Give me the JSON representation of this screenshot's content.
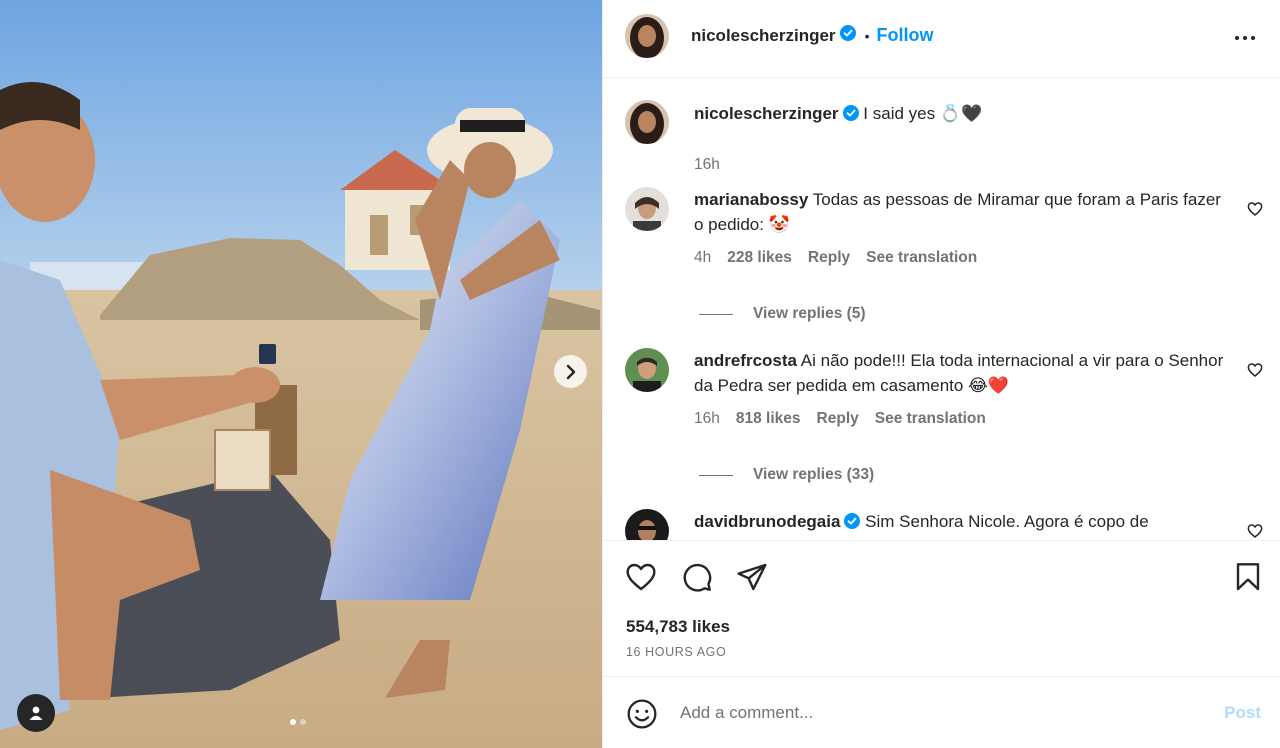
{
  "post": {
    "author": "nicolescherzinger",
    "follow_label": "Follow",
    "bullet": "•",
    "caption_text": "I said yes 💍🖤",
    "caption_time": "16h",
    "slide_count": 2,
    "active_slide": 1
  },
  "comments": [
    {
      "username": "marianabossy",
      "verified": false,
      "text": "Todas as pessoas de Miramar que foram a Paris fazer o pedido: 🤡",
      "time": "4h",
      "likes": "228 likes",
      "reply": "Reply",
      "translate": "See translation",
      "view_replies": "View replies (5)"
    },
    {
      "username": "andrefrcosta",
      "verified": false,
      "text": "Ai não pode!!! Ela toda internacional a vir para o Senhor da Pedra ser pedida em casamento 😂❤️",
      "time": "16h",
      "likes": "818 likes",
      "reply": "Reply",
      "translate": "See translation",
      "view_replies": "View replies (33)"
    },
    {
      "username": "davidbrunodegaia",
      "verified": true,
      "text": "Sim Senhora Nicole. Agora é copo de"
    }
  ],
  "stats": {
    "likes": "554,783 likes",
    "posted": "16 HOURS AGO"
  },
  "composer": {
    "placeholder": "Add a comment...",
    "post_label": "Post"
  },
  "colors": {
    "link": "#0095f6",
    "verified": "#0095f6",
    "muted": "#737373",
    "post_disabled": "#b3dbff"
  },
  "icons": [
    "more-options-icon",
    "verified-icon",
    "heart-icon",
    "comment-icon",
    "share-icon",
    "bookmark-icon",
    "emoji-icon",
    "user-tag-icon",
    "chevron-right-icon"
  ]
}
